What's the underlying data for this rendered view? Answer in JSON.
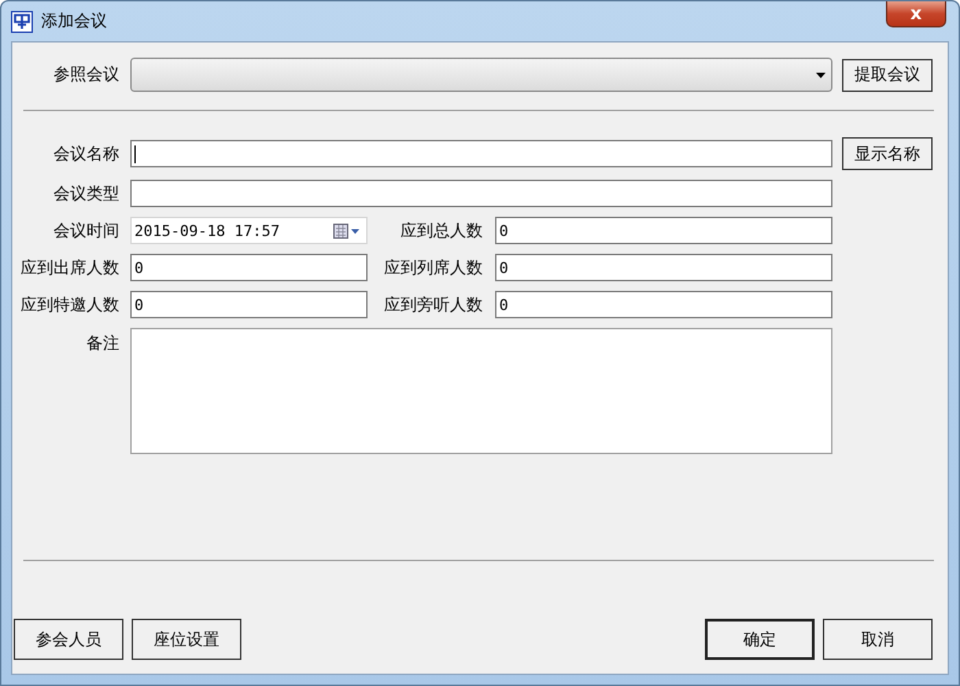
{
  "window": {
    "title": "添加会议",
    "close": "x"
  },
  "reference": {
    "label": "参照会议",
    "button": "提取会议"
  },
  "name": {
    "label": "会议名称",
    "focused": true,
    "button": "显示名称"
  },
  "type": {
    "label": "会议类型"
  },
  "time": {
    "label": "会议时间",
    "value": "2015-09-18 17:57"
  },
  "counts": [
    {
      "label": "应到总人数",
      "value": "0"
    },
    {
      "label": "应到出席人数",
      "value": "0"
    },
    {
      "label": "应到列席人数",
      "value": "0"
    },
    {
      "label": "应到特邀人数",
      "value": "0"
    },
    {
      "label": "应到旁听人数",
      "value": "0"
    }
  ],
  "remarks": {
    "label": "备注"
  },
  "buttons": [
    {
      "label": "参会人员",
      "default": false
    },
    {
      "label": "座位设置",
      "default": false
    },
    {
      "label": "确定",
      "default": true
    },
    {
      "label": "取消",
      "default": false
    }
  ]
}
